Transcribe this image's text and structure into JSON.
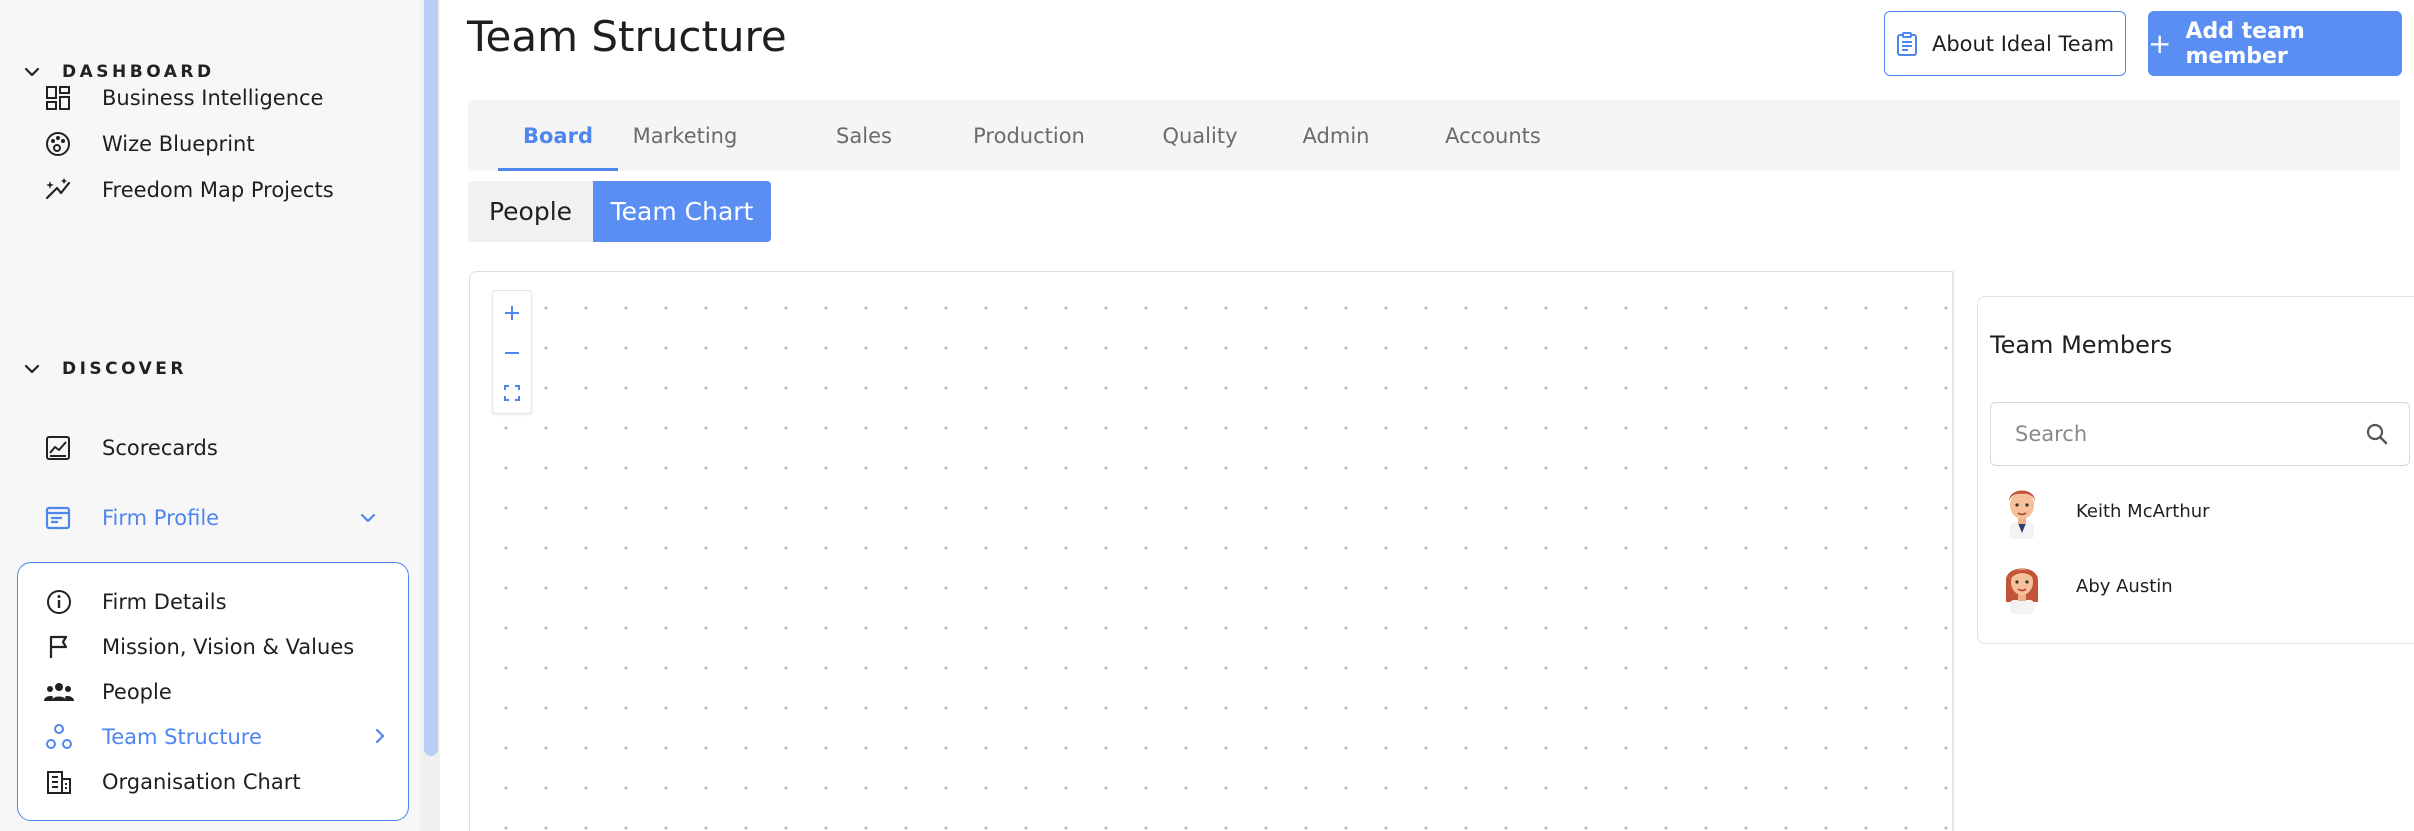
{
  "sidebar": {
    "sections": [
      {
        "title": "DASHBOARD",
        "items": [
          {
            "label": "Business Intelligence",
            "icon": "dashboard-grid-icon"
          },
          {
            "label": "Wize Blueprint",
            "icon": "palette-icon"
          },
          {
            "label": "Freedom Map Projects",
            "icon": "magic-wand-icon"
          }
        ]
      },
      {
        "title": "DISCOVER",
        "items": [
          {
            "label": "Scorecards",
            "icon": "chart-square-icon"
          },
          {
            "label": "Firm Profile",
            "icon": "profile-card-icon",
            "active": true
          }
        ]
      }
    ],
    "firm_profile_submenu": [
      {
        "label": "Firm Details",
        "icon": "info-icon"
      },
      {
        "label": "Mission, Vision & Values",
        "icon": "flag-icon"
      },
      {
        "label": "People",
        "icon": "group-icon"
      },
      {
        "label": "Team Structure",
        "icon": "team-structure-icon",
        "active": true
      },
      {
        "label": "Organisation Chart",
        "icon": "building-icon"
      }
    ]
  },
  "header": {
    "title": "Team Structure",
    "about_button": "About Ideal Team",
    "add_button": "Add team member",
    "add_button_icon": "+"
  },
  "tabs": [
    {
      "label": "Board",
      "active": true
    },
    {
      "label": "Marketing"
    },
    {
      "label": "Sales"
    },
    {
      "label": "Production"
    },
    {
      "label": "Quality"
    },
    {
      "label": "Admin"
    },
    {
      "label": "Accounts"
    }
  ],
  "view_toggle": {
    "options": [
      "People",
      "Team Chart"
    ],
    "selected": "Team Chart"
  },
  "team_panel": {
    "title": "Team Members",
    "search_placeholder": "Search",
    "search_value": "",
    "members": [
      {
        "name": "Keith McArthur",
        "avatar": "male-avatar-icon"
      },
      {
        "name": "Aby Austin",
        "avatar": "female-avatar-icon"
      }
    ]
  },
  "colors": {
    "accent": "#4e86ee",
    "button_fill": "#5a8ef2",
    "sidebar_bg": "#f7f7f7",
    "tabbar_bg": "#f5f5f5"
  }
}
